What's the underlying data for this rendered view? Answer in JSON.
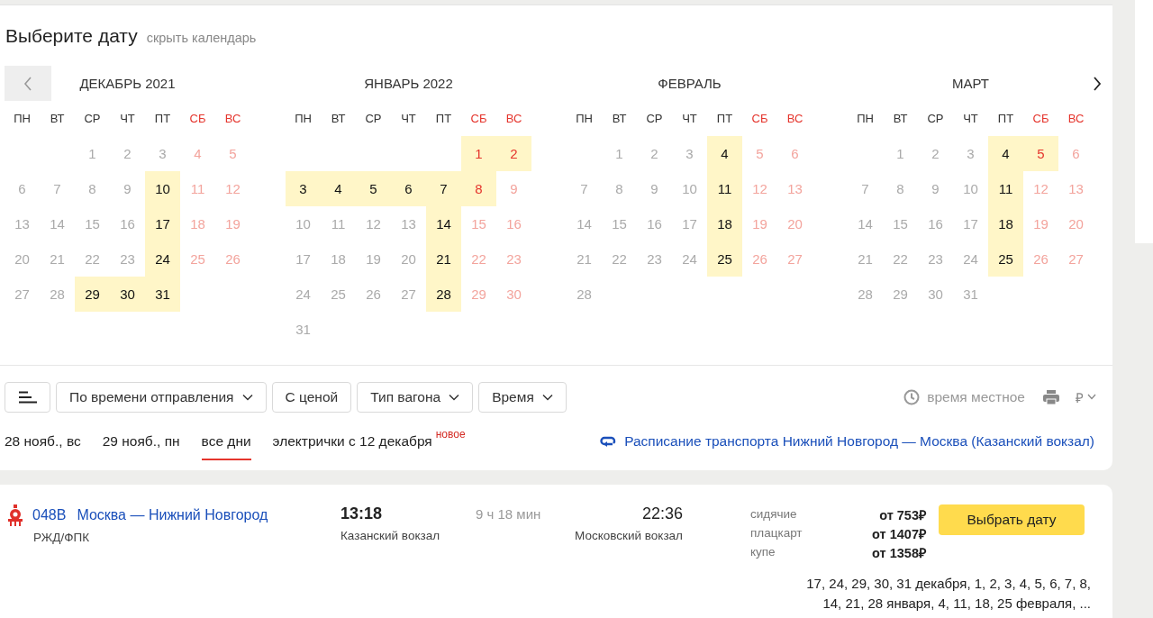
{
  "header": {
    "title": "Выберите дату",
    "hide_link": "скрыть календарь"
  },
  "months": [
    {
      "title": "ДЕКАБРЬ 2021",
      "weekdays": [
        {
          "label": "ПН",
          "weekend": false
        },
        {
          "label": "ВТ",
          "weekend": false
        },
        {
          "label": "СР",
          "weekend": false
        },
        {
          "label": "ЧТ",
          "weekend": false
        },
        {
          "label": "ПТ",
          "weekend": false
        },
        {
          "label": "СБ",
          "weekend": true
        },
        {
          "label": "ВС",
          "weekend": true
        }
      ],
      "days": [
        {
          "kind": "blank"
        },
        {
          "kind": "blank"
        },
        {
          "kind": "day",
          "day": "1",
          "available": false
        },
        {
          "kind": "day",
          "day": "2",
          "available": false
        },
        {
          "kind": "day",
          "day": "3",
          "available": false
        },
        {
          "kind": "day",
          "day": "4",
          "available": false
        },
        {
          "kind": "day",
          "day": "5",
          "available": false
        },
        {
          "kind": "day",
          "day": "6",
          "available": false
        },
        {
          "kind": "day",
          "day": "7",
          "available": false
        },
        {
          "kind": "day",
          "day": "8",
          "available": false
        },
        {
          "kind": "day",
          "day": "9",
          "available": false
        },
        {
          "kind": "day",
          "day": "10",
          "available": true
        },
        {
          "kind": "day",
          "day": "11",
          "available": false
        },
        {
          "kind": "day",
          "day": "12",
          "available": false
        },
        {
          "kind": "day",
          "day": "13",
          "available": false
        },
        {
          "kind": "day",
          "day": "14",
          "available": false
        },
        {
          "kind": "day",
          "day": "15",
          "available": false
        },
        {
          "kind": "day",
          "day": "16",
          "available": false
        },
        {
          "kind": "day",
          "day": "17",
          "available": true
        },
        {
          "kind": "day",
          "day": "18",
          "available": false
        },
        {
          "kind": "day",
          "day": "19",
          "available": false
        },
        {
          "kind": "day",
          "day": "20",
          "available": false
        },
        {
          "kind": "day",
          "day": "21",
          "available": false
        },
        {
          "kind": "day",
          "day": "22",
          "available": false
        },
        {
          "kind": "day",
          "day": "23",
          "available": false
        },
        {
          "kind": "day",
          "day": "24",
          "available": true
        },
        {
          "kind": "day",
          "day": "25",
          "available": false
        },
        {
          "kind": "day",
          "day": "26",
          "available": false
        },
        {
          "kind": "day",
          "day": "27",
          "available": false
        },
        {
          "kind": "day",
          "day": "28",
          "available": false
        },
        {
          "kind": "day",
          "day": "29",
          "available": true
        },
        {
          "kind": "day",
          "day": "30",
          "available": true
        },
        {
          "kind": "day",
          "day": "31",
          "available": true
        }
      ]
    },
    {
      "title": "ЯНВАРЬ 2022",
      "weekdays": [
        {
          "label": "ПН",
          "weekend": false
        },
        {
          "label": "ВТ",
          "weekend": false
        },
        {
          "label": "СР",
          "weekend": false
        },
        {
          "label": "ЧТ",
          "weekend": false
        },
        {
          "label": "ПТ",
          "weekend": false
        },
        {
          "label": "СБ",
          "weekend": true
        },
        {
          "label": "ВС",
          "weekend": true
        }
      ],
      "days": [
        {
          "kind": "blank"
        },
        {
          "kind": "blank"
        },
        {
          "kind": "blank"
        },
        {
          "kind": "blank"
        },
        {
          "kind": "blank"
        },
        {
          "kind": "day",
          "day": "1",
          "available": true
        },
        {
          "kind": "day",
          "day": "2",
          "available": true
        },
        {
          "kind": "day",
          "day": "3",
          "available": true
        },
        {
          "kind": "day",
          "day": "4",
          "available": true
        },
        {
          "kind": "day",
          "day": "5",
          "available": true
        },
        {
          "kind": "day",
          "day": "6",
          "available": true
        },
        {
          "kind": "day",
          "day": "7",
          "available": true
        },
        {
          "kind": "day",
          "day": "8",
          "available": true
        },
        {
          "kind": "day",
          "day": "9",
          "available": false
        },
        {
          "kind": "day",
          "day": "10",
          "available": false
        },
        {
          "kind": "day",
          "day": "11",
          "available": false
        },
        {
          "kind": "day",
          "day": "12",
          "available": false
        },
        {
          "kind": "day",
          "day": "13",
          "available": false
        },
        {
          "kind": "day",
          "day": "14",
          "available": true
        },
        {
          "kind": "day",
          "day": "15",
          "available": false
        },
        {
          "kind": "day",
          "day": "16",
          "available": false
        },
        {
          "kind": "day",
          "day": "17",
          "available": false
        },
        {
          "kind": "day",
          "day": "18",
          "available": false
        },
        {
          "kind": "day",
          "day": "19",
          "available": false
        },
        {
          "kind": "day",
          "day": "20",
          "available": false
        },
        {
          "kind": "day",
          "day": "21",
          "available": true
        },
        {
          "kind": "day",
          "day": "22",
          "available": false
        },
        {
          "kind": "day",
          "day": "23",
          "available": false
        },
        {
          "kind": "day",
          "day": "24",
          "available": false
        },
        {
          "kind": "day",
          "day": "25",
          "available": false
        },
        {
          "kind": "day",
          "day": "26",
          "available": false
        },
        {
          "kind": "day",
          "day": "27",
          "available": false
        },
        {
          "kind": "day",
          "day": "28",
          "available": true
        },
        {
          "kind": "day",
          "day": "29",
          "available": false
        },
        {
          "kind": "day",
          "day": "30",
          "available": false
        },
        {
          "kind": "day",
          "day": "31",
          "available": false
        }
      ]
    },
    {
      "title": "ФЕВРАЛЬ",
      "weekdays": [
        {
          "label": "ПН",
          "weekend": false
        },
        {
          "label": "ВТ",
          "weekend": false
        },
        {
          "label": "СР",
          "weekend": false
        },
        {
          "label": "ЧТ",
          "weekend": false
        },
        {
          "label": "ПТ",
          "weekend": false
        },
        {
          "label": "СБ",
          "weekend": true
        },
        {
          "label": "ВС",
          "weekend": true
        }
      ],
      "days": [
        {
          "kind": "blank"
        },
        {
          "kind": "day",
          "day": "1",
          "available": false
        },
        {
          "kind": "day",
          "day": "2",
          "available": false
        },
        {
          "kind": "day",
          "day": "3",
          "available": false
        },
        {
          "kind": "day",
          "day": "4",
          "available": true
        },
        {
          "kind": "day",
          "day": "5",
          "available": false
        },
        {
          "kind": "day",
          "day": "6",
          "available": false
        },
        {
          "kind": "day",
          "day": "7",
          "available": false
        },
        {
          "kind": "day",
          "day": "8",
          "available": false
        },
        {
          "kind": "day",
          "day": "9",
          "available": false
        },
        {
          "kind": "day",
          "day": "10",
          "available": false
        },
        {
          "kind": "day",
          "day": "11",
          "available": true
        },
        {
          "kind": "day",
          "day": "12",
          "available": false
        },
        {
          "kind": "day",
          "day": "13",
          "available": false
        },
        {
          "kind": "day",
          "day": "14",
          "available": false
        },
        {
          "kind": "day",
          "day": "15",
          "available": false
        },
        {
          "kind": "day",
          "day": "16",
          "available": false
        },
        {
          "kind": "day",
          "day": "17",
          "available": false
        },
        {
          "kind": "day",
          "day": "18",
          "available": true
        },
        {
          "kind": "day",
          "day": "19",
          "available": false
        },
        {
          "kind": "day",
          "day": "20",
          "available": false
        },
        {
          "kind": "day",
          "day": "21",
          "available": false
        },
        {
          "kind": "day",
          "day": "22",
          "available": false
        },
        {
          "kind": "day",
          "day": "23",
          "available": false
        },
        {
          "kind": "day",
          "day": "24",
          "available": false
        },
        {
          "kind": "day",
          "day": "25",
          "available": true
        },
        {
          "kind": "day",
          "day": "26",
          "available": false
        },
        {
          "kind": "day",
          "day": "27",
          "available": false
        },
        {
          "kind": "day",
          "day": "28",
          "available": false
        }
      ]
    },
    {
      "title": "МАРТ",
      "weekdays": [
        {
          "label": "ПН",
          "weekend": false
        },
        {
          "label": "ВТ",
          "weekend": false
        },
        {
          "label": "СР",
          "weekend": false
        },
        {
          "label": "ЧТ",
          "weekend": false
        },
        {
          "label": "ПТ",
          "weekend": false
        },
        {
          "label": "СБ",
          "weekend": true
        },
        {
          "label": "ВС",
          "weekend": true
        }
      ],
      "days": [
        {
          "kind": "blank"
        },
        {
          "kind": "day",
          "day": "1",
          "available": false
        },
        {
          "kind": "day",
          "day": "2",
          "available": false
        },
        {
          "kind": "day",
          "day": "3",
          "available": false
        },
        {
          "kind": "day",
          "day": "4",
          "available": true
        },
        {
          "kind": "day",
          "day": "5",
          "available": true
        },
        {
          "kind": "day",
          "day": "6",
          "available": false
        },
        {
          "kind": "day",
          "day": "7",
          "available": false
        },
        {
          "kind": "day",
          "day": "8",
          "available": false
        },
        {
          "kind": "day",
          "day": "9",
          "available": false
        },
        {
          "kind": "day",
          "day": "10",
          "available": false
        },
        {
          "kind": "day",
          "day": "11",
          "available": true
        },
        {
          "kind": "day",
          "day": "12",
          "available": false
        },
        {
          "kind": "day",
          "day": "13",
          "available": false
        },
        {
          "kind": "day",
          "day": "14",
          "available": false
        },
        {
          "kind": "day",
          "day": "15",
          "available": false
        },
        {
          "kind": "day",
          "day": "16",
          "available": false
        },
        {
          "kind": "day",
          "day": "17",
          "available": false
        },
        {
          "kind": "day",
          "day": "18",
          "available": true
        },
        {
          "kind": "day",
          "day": "19",
          "available": false
        },
        {
          "kind": "day",
          "day": "20",
          "available": false
        },
        {
          "kind": "day",
          "day": "21",
          "available": false
        },
        {
          "kind": "day",
          "day": "22",
          "available": false
        },
        {
          "kind": "day",
          "day": "23",
          "available": false
        },
        {
          "kind": "day",
          "day": "24",
          "available": false
        },
        {
          "kind": "day",
          "day": "25",
          "available": true
        },
        {
          "kind": "day",
          "day": "26",
          "available": false
        },
        {
          "kind": "day",
          "day": "27",
          "available": false
        },
        {
          "kind": "day",
          "day": "28",
          "available": false
        },
        {
          "kind": "day",
          "day": "29",
          "available": false
        },
        {
          "kind": "day",
          "day": "30",
          "available": false
        },
        {
          "kind": "day",
          "day": "31",
          "available": false
        }
      ]
    }
  ],
  "filters": [
    {
      "label": "По времени отправления",
      "kind": "dropdown"
    },
    {
      "label": "С ценой",
      "kind": "plain"
    },
    {
      "label": "Тип вагона",
      "kind": "dropdown"
    },
    {
      "label": "Время",
      "kind": "dropdown"
    }
  ],
  "local_time": "время местное",
  "currency": "₽",
  "date_tabs": [
    {
      "label": "28 нояб., вс",
      "selected": false
    },
    {
      "label": "29 нояб., пн",
      "selected": false
    },
    {
      "label": "все дни",
      "selected": true
    },
    {
      "label": "электрички с 12 декабря",
      "selected": false,
      "badge": "новое"
    }
  ],
  "schedule_link": "Расписание транспорта Нижний Новгород — Москва (Казанский вокзал)",
  "train": {
    "number": "048В",
    "route": "Москва — Нижний Новгород",
    "carrier": "РЖД/ФПК",
    "departure_time": "13:18",
    "departure_station": "Казанский вокзал",
    "duration": "9 ч 18 мин",
    "arrival_time": "22:36",
    "arrival_station": "Московский вокзал",
    "fares": [
      {
        "class": "сидячие",
        "price": "от 753₽"
      },
      {
        "class": "плацкарт",
        "price": "от 1407₽"
      },
      {
        "class": "купе",
        "price": "от 1358₽"
      }
    ],
    "button": "Выбрать дату",
    "dates": "17, 24, 29, 30, 31 декабря, 1, 2, 3, 4, 5, 6, 7, 8, 14, 21, 28 января, 4, 11, 18, 25 февраля, ..."
  }
}
